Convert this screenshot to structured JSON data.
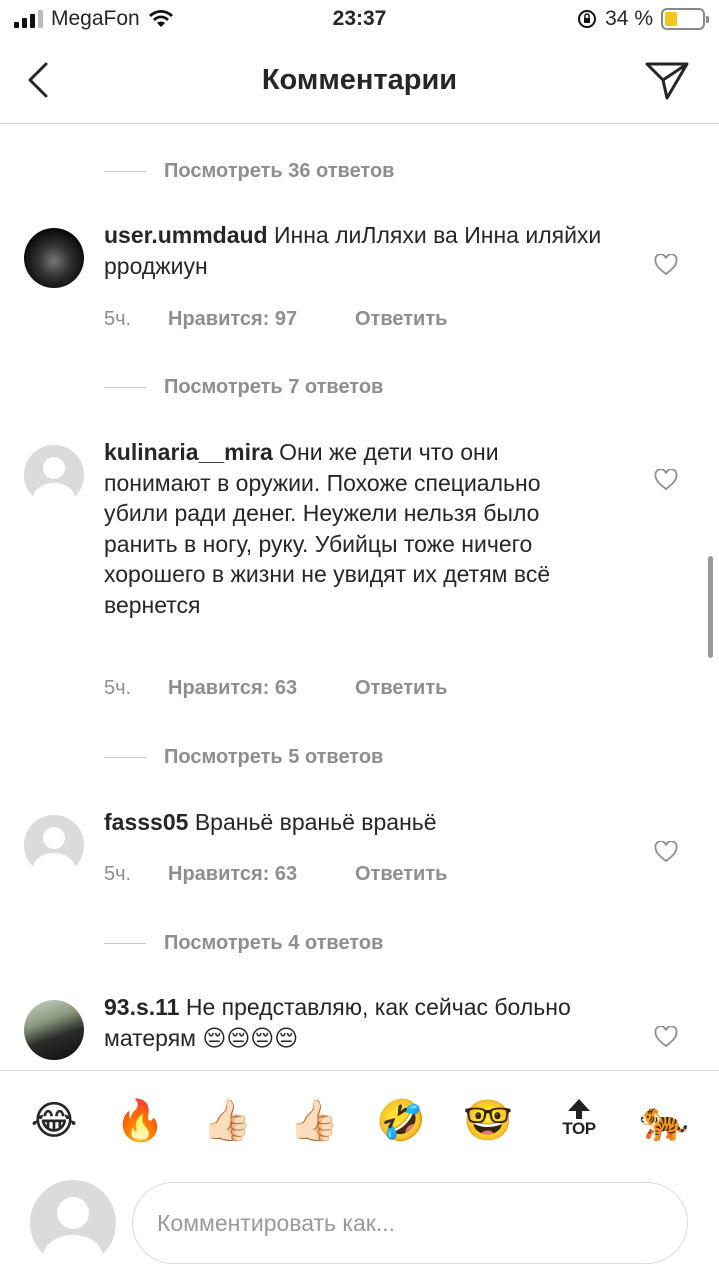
{
  "status_bar": {
    "carrier": "MegaFon",
    "time": "23:37",
    "battery": "34 %",
    "battery_level": 0.34
  },
  "header": {
    "title": "Комментарии",
    "back_icon": "chevron-left-icon",
    "send_icon": "paper-plane-icon"
  },
  "replies_links": [
    "Посмотреть 36 ответов",
    "Посмотреть 7 ответов",
    "Посмотреть 5 ответов",
    "Посмотреть 4 ответов"
  ],
  "comments": [
    {
      "username": "user.ummdaud",
      "text": "Инна лиЛляхи ва Инна иляйхи рроджиун",
      "time": "5ч.",
      "likes": "Нравится: 97",
      "reply": "Ответить"
    },
    {
      "username": "kulinaria__mira",
      "text": "Они же дети что они понимают в оружии. Похоже специально убили ради денег. Неужели нельзя было ранить в ногу, руку. Убийцы тоже ничего хорошего в жизни не увидят их детям всё вернется",
      "time": "5ч.",
      "likes": "Нравится: 63",
      "reply": "Ответить"
    },
    {
      "username": "fasss05",
      "text": "Враньё враньё враньё",
      "time": "5ч.",
      "likes": "Нравится: 63",
      "reply": "Ответить"
    },
    {
      "username": "93.s.11",
      "text": "Не представляю,  как сейчас больно матерям 😔😔😔😔"
    }
  ],
  "emoji_bar": [
    "😂",
    "🔥",
    "👍🏻",
    "👍🏻",
    "🤣",
    "🤓",
    "TOP",
    "🐅"
  ],
  "composer": {
    "placeholder": "Комментировать как..."
  },
  "colors": {
    "text": "#262626",
    "secondary": "#8e8e8e",
    "divider": "#dbdbdb",
    "battery": "#f7c41a"
  }
}
